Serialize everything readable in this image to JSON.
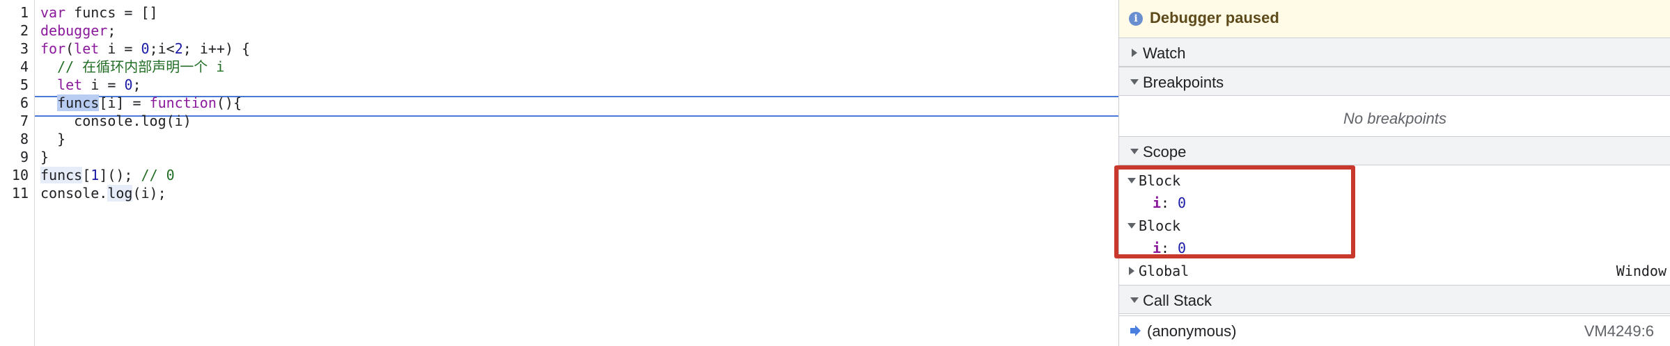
{
  "editor": {
    "line_numbers": [
      "1",
      "2",
      "3",
      "4",
      "5",
      "6",
      "7",
      "8",
      "9",
      "10",
      "11"
    ],
    "lines": [
      [
        {
          "t": "var",
          "c": "kw"
        },
        {
          "t": " funcs = []",
          "c": ""
        }
      ],
      [
        {
          "t": "debugger",
          "c": "kw"
        },
        {
          "t": ";",
          "c": ""
        }
      ],
      [
        {
          "t": "for",
          "c": "kw"
        },
        {
          "t": "(",
          "c": ""
        },
        {
          "t": "let",
          "c": "kw"
        },
        {
          "t": " i = ",
          "c": ""
        },
        {
          "t": "0",
          "c": "num"
        },
        {
          "t": ";i<",
          "c": ""
        },
        {
          "t": "2",
          "c": "num"
        },
        {
          "t": "; i++) {",
          "c": ""
        }
      ],
      [
        {
          "t": "  // 在循环内部声明一个 i",
          "c": "cmt"
        }
      ],
      [
        {
          "t": "  ",
          "c": ""
        },
        {
          "t": "let",
          "c": "kw"
        },
        {
          "t": " i = ",
          "c": ""
        },
        {
          "t": "0",
          "c": "num"
        },
        {
          "t": ";",
          "c": ""
        }
      ],
      [
        {
          "t": "  ",
          "c": ""
        },
        {
          "t": "funcs",
          "c": "fn-hl"
        },
        {
          "t": "[i] = ",
          "c": ""
        },
        {
          "t": "function",
          "c": "kw"
        },
        {
          "t": "(){",
          "c": ""
        }
      ],
      [
        {
          "t": "    console.log(i)",
          "c": ""
        }
      ],
      [
        {
          "t": "  }",
          "c": ""
        }
      ],
      [
        {
          "t": "}",
          "c": ""
        }
      ],
      [
        {
          "t": "funcs",
          "c": "hl-soft"
        },
        {
          "t": "[",
          "c": ""
        },
        {
          "t": "1",
          "c": "num"
        },
        {
          "t": "](); ",
          "c": ""
        },
        {
          "t": "// 0",
          "c": "cmt"
        }
      ],
      [
        {
          "t": "console.",
          "c": ""
        },
        {
          "t": "log",
          "c": "hl-soft"
        },
        {
          "t": "(i);",
          "c": ""
        }
      ]
    ]
  },
  "debugger": {
    "status": "Debugger paused",
    "watch_label": "Watch",
    "breakpoints_label": "Breakpoints",
    "no_breakpoints": "No breakpoints",
    "scope_label": "Scope",
    "scope": [
      {
        "label": "Block",
        "var_name": "i",
        "var_value": "0"
      },
      {
        "label": "Block",
        "var_name": "i",
        "var_value": "0"
      }
    ],
    "global_label": "Global",
    "global_value": "Window",
    "callstack_label": "Call Stack",
    "frame_name": "(anonymous)",
    "frame_location": "VM4249:6"
  },
  "colors": {
    "highlight_box": "#c8382d",
    "execution_line": "#4a78d6",
    "paused_bar": "#fffbe6"
  }
}
